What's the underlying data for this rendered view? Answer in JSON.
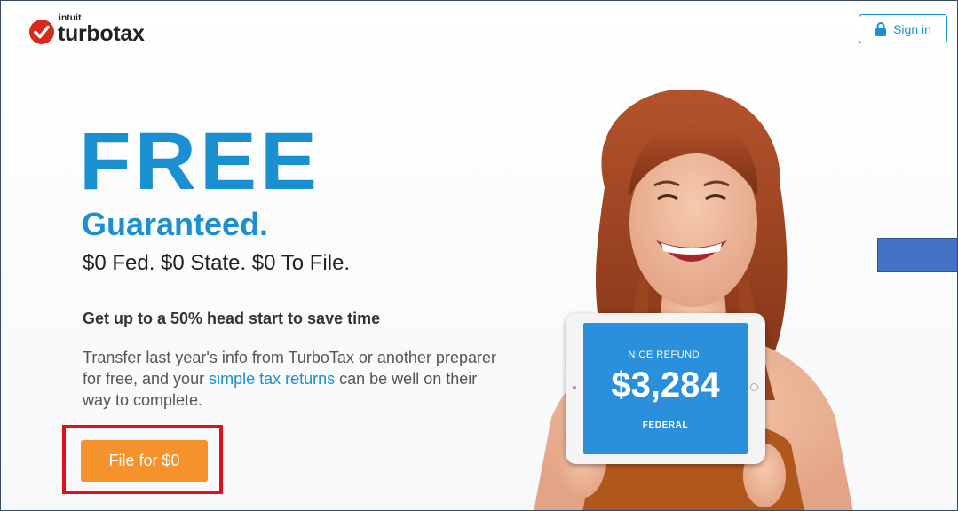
{
  "header": {
    "logo_intuit": "intuit",
    "logo_turbotax": "turbotax",
    "signin_label": "Sign in"
  },
  "hero": {
    "headline": "FREE",
    "subheadline": "Guaranteed.",
    "tagline": "$0 Fed. $0 State. $0 To File.",
    "headstart": "Get up to a 50% head start to save time",
    "transfer_before": "Transfer last year's info from TurboTax or another preparer for free, and your ",
    "transfer_link": "simple tax returns",
    "transfer_after": " can be well on their way to complete.",
    "cta_label": "File for $0"
  },
  "tablet": {
    "caption": "NICE REFUND!",
    "amount": "$3,284",
    "footer": "FEDERAL"
  },
  "colors": {
    "brand_blue": "#1a8fd1",
    "cta_orange": "#f5922b",
    "highlight_red": "#e0101a",
    "overlay_blue": "#4472c4"
  },
  "icons": [
    "intuit-check-icon",
    "lock-icon"
  ]
}
